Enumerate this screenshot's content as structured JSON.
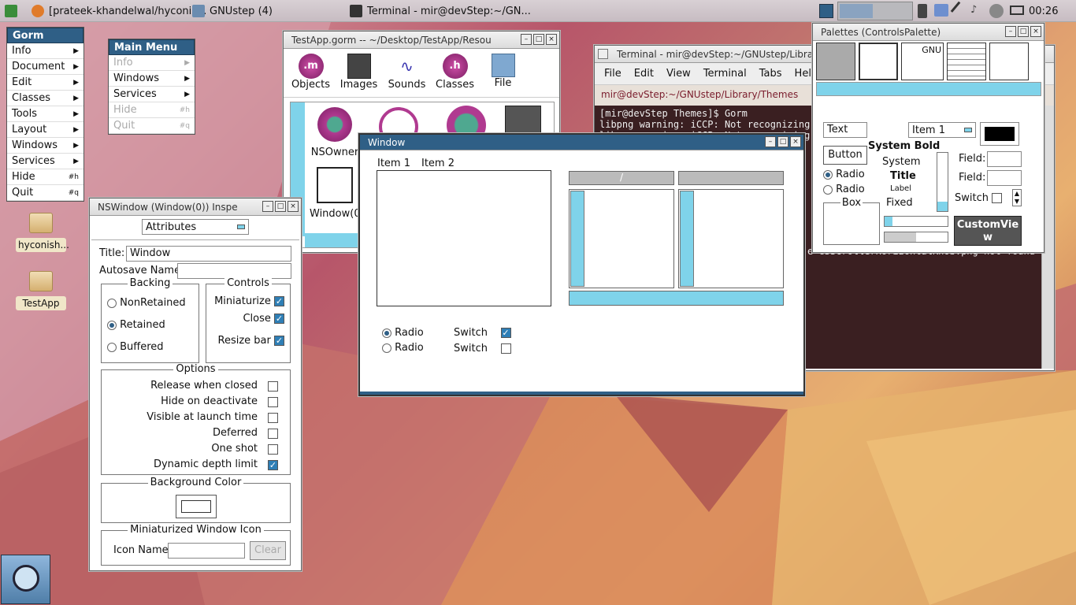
{
  "taskbar": {
    "items": [
      {
        "label": "[prateek-khandelwal/hyconis..."
      },
      {
        "label": "GNUstep (4)"
      },
      {
        "label": "Terminal - mir@devStep:~/GN..."
      }
    ],
    "clock": "00:26"
  },
  "gorm_menu": {
    "title": "Gorm",
    "items": [
      {
        "label": "Info",
        "key": "▶"
      },
      {
        "label": "Document",
        "key": "▶"
      },
      {
        "label": "Edit",
        "key": "▶"
      },
      {
        "label": "Classes",
        "key": "▶"
      },
      {
        "label": "Tools",
        "key": "▶"
      },
      {
        "label": "Layout",
        "key": "▶"
      },
      {
        "label": "Windows",
        "key": "▶"
      },
      {
        "label": "Services",
        "key": "▶"
      },
      {
        "label": "Hide",
        "key": "#h"
      },
      {
        "label": "Quit",
        "key": "#q"
      }
    ]
  },
  "main_menu": {
    "title": "Main Menu",
    "items": [
      {
        "label": "Info",
        "key": "▶"
      },
      {
        "label": "Windows",
        "key": "▶"
      },
      {
        "label": "Services",
        "key": "▶"
      },
      {
        "label": "Hide",
        "key": "#h"
      },
      {
        "label": "Quit",
        "key": "#q"
      }
    ]
  },
  "desktop": {
    "icons": [
      {
        "label": "hyconish..."
      },
      {
        "label": "TestApp"
      }
    ]
  },
  "testapp_window": {
    "title": "TestApp.gorm  -- ~/Desktop/TestApp/Resou",
    "toolbar": [
      {
        "label": "Objects"
      },
      {
        "label": "Images"
      },
      {
        "label": "Sounds"
      },
      {
        "label": "Classes"
      },
      {
        "label": "File"
      }
    ],
    "objects": [
      {
        "label": "NSOwner"
      },
      {
        "label": "Window(0"
      }
    ]
  },
  "terminal": {
    "title": "Terminal - mir@devStep:~/GNUstep/Library/Th",
    "menu": [
      "File",
      "Edit",
      "View",
      "Terminal",
      "Tabs",
      "Help"
    ],
    "path": "mir@devStep:~/GNUstep/Library/Themes",
    "lines": [
      "[mir@devStep Themes]$ Gorm",
      "libpng warning: iCCP: Not recognizing",
      "libpng warning: iCCP: Not recognizing"
    ],
    "tail": "e GSScrollerHorizontalKnob.png not found i"
  },
  "palettes": {
    "title": "Palettes (ControlsPalette)",
    "text_field": "Text",
    "popup": "Item 1",
    "button": "Button",
    "fonts": [
      "System Bold",
      "System",
      "Title",
      "Label",
      "Fixed"
    ],
    "radio1": "Radio",
    "radio2": "Radio",
    "box": "Box",
    "field1": "Field:",
    "field2": "Field:",
    "switch": "Switch",
    "custom_view": "CustomView",
    "gnu": "GNU"
  },
  "inspector": {
    "title": "NSWindow (Window(0)) Inspe",
    "popup": "Attributes",
    "title_label": "Title:",
    "title_value": "Window",
    "autosave_label": "Autosave Name",
    "backing": {
      "label": "Backing",
      "options": [
        "NonRetained",
        "Retained",
        "Buffered"
      ],
      "selected": 1
    },
    "controls": {
      "label": "Controls",
      "items": [
        {
          "label": "Miniaturize",
          "checked": true
        },
        {
          "label": "Close",
          "checked": true
        },
        {
          "label": "Resize bar",
          "checked": true
        }
      ]
    },
    "options": {
      "label": "Options",
      "items": [
        {
          "label": "Release when closed",
          "checked": false
        },
        {
          "label": "Hide on deactivate",
          "checked": false
        },
        {
          "label": "Visible at launch time",
          "checked": false
        },
        {
          "label": "Deferred",
          "checked": false
        },
        {
          "label": "One shot",
          "checked": false
        },
        {
          "label": "Dynamic depth limit",
          "checked": true
        }
      ]
    },
    "background_color": "Background Color",
    "mini_icon": "Miniaturized Window Icon",
    "icon_name_label": "Icon Name",
    "clear_button": "Clear"
  },
  "window": {
    "title": "Window",
    "tab1": "Item 1",
    "tab2": "Item 2",
    "col_header": "/",
    "radio1": "Radio",
    "radio2": "Radio",
    "switch1": "Switch",
    "switch2": "Switch"
  },
  "colors": {
    "accent": "#2f5f86",
    "selection": "#7fd3ea",
    "check": "#2f7fb6"
  }
}
